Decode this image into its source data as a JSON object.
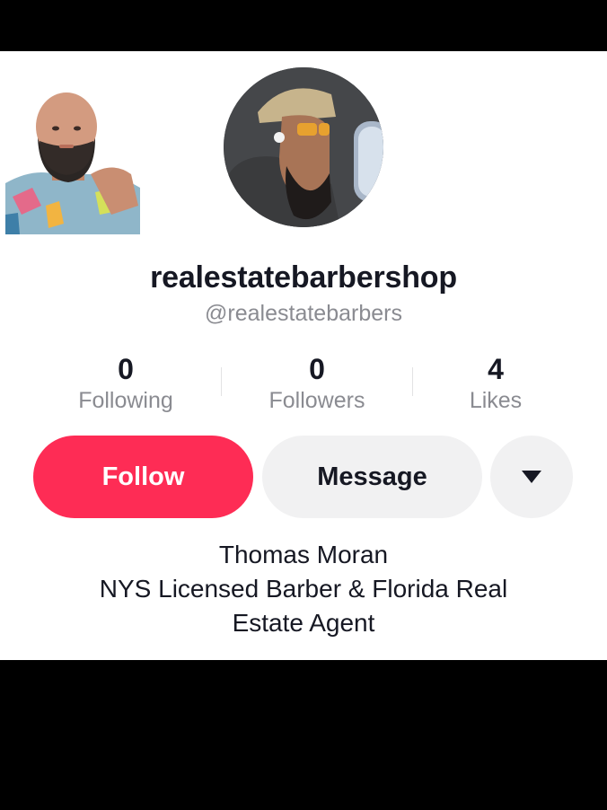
{
  "profile": {
    "display_name": "realestatebarbershop",
    "username": "@realestatebarbers"
  },
  "stats": [
    {
      "value": "0",
      "label": "Following"
    },
    {
      "value": "0",
      "label": "Followers"
    },
    {
      "value": "4",
      "label": "Likes"
    }
  ],
  "actions": {
    "follow_label": "Follow",
    "message_label": "Message",
    "more_icon": "caret-down-icon"
  },
  "bio": {
    "lines": [
      "Thomas Moran",
      "NYS Licensed Barber & Florida Real",
      "Estate Agent"
    ]
  },
  "colors": {
    "follow": "#fe2c55",
    "secondary_button": "#f1f1f2",
    "muted_text": "#8a8b91",
    "primary_text": "#161823"
  }
}
